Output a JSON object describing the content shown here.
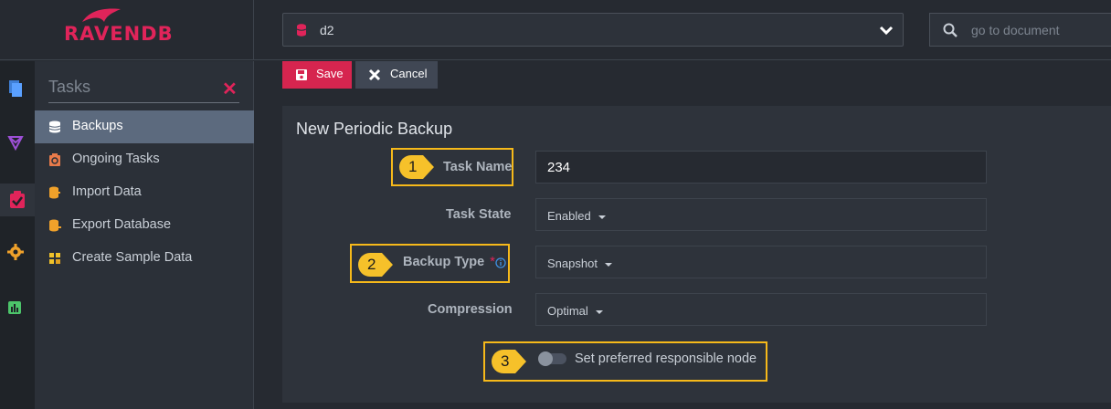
{
  "brand": {
    "logo_text": "RAVENDB",
    "accent": "#e0245a"
  },
  "header": {
    "database": "d2",
    "goto_placeholder": "go to document"
  },
  "iconbar": [
    "documents-icon",
    "indexes-icon",
    "tasks-icon",
    "settings-icon",
    "stats-icon"
  ],
  "menu": {
    "title": "Tasks",
    "items": [
      {
        "label": "Backups",
        "icon": "backup-icon",
        "active": true
      },
      {
        "label": "Ongoing Tasks",
        "icon": "ongoing-tasks-icon"
      },
      {
        "label": "Import Data",
        "icon": "import-icon"
      },
      {
        "label": "Export Database",
        "icon": "export-icon"
      },
      {
        "label": "Create Sample Data",
        "icon": "sample-data-icon"
      }
    ]
  },
  "toolbar": {
    "save_label": "Save",
    "cancel_label": "Cancel"
  },
  "form": {
    "title": "New Periodic Backup",
    "task_name_label": "Task Name",
    "task_name_value": "234",
    "task_state_label": "Task State",
    "task_state_value": "Enabled",
    "backup_type_label": "Backup Type",
    "backup_type_required": "*",
    "backup_type_value": "Snapshot",
    "compression_label": "Compression",
    "compression_value": "Optimal",
    "preferred_node_label": "Set preferred responsible node",
    "preferred_node_enabled": false
  },
  "callouts": [
    "1",
    "2",
    "3"
  ],
  "callout_color": "#f6b91a"
}
